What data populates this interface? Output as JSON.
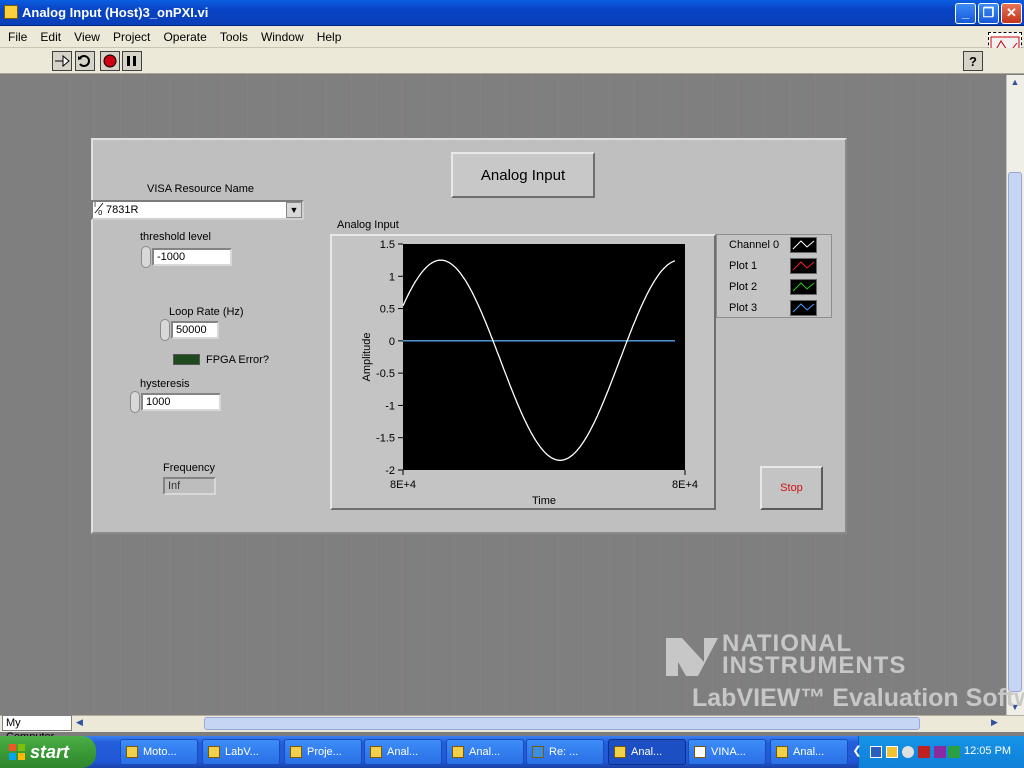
{
  "window": {
    "title": "Analog Input (Host)3_onPXI.vi",
    "minimize": "_",
    "maximize": "❐",
    "close": "✕"
  },
  "menu": [
    "File",
    "Edit",
    "View",
    "Project",
    "Operate",
    "Tools",
    "Window",
    "Help"
  ],
  "toolbar": {
    "help": "?"
  },
  "controls": {
    "visa_label": "VISA Resource Name",
    "visa_value": "7831R",
    "visa_prefix": "I/0",
    "threshold_label": "threshold level",
    "threshold_value": "-1000",
    "loop_rate_label": "Loop Rate (Hz)",
    "loop_rate_value": "50000",
    "fpga_error_label": "FPGA Error?",
    "hysteresis_label": "hysteresis",
    "hysteresis_value": "1000",
    "frequency_label": "Frequency",
    "frequency_value": "Inf",
    "decoration_title": "Analog Input",
    "stop_label": "Stop"
  },
  "chart_data": {
    "type": "line",
    "title": "Analog Input",
    "xlabel": "Time",
    "ylabel": "Amplitude",
    "ylim": [
      -2,
      1.5
    ],
    "yticks": [
      "1.5",
      "1",
      "0.5",
      "0",
      "-0.5",
      "-1",
      "-1.5",
      "-2"
    ],
    "xticks": [
      "8E+4",
      "8E+4"
    ],
    "background": "#000000",
    "series": [
      {
        "name": "Channel 0",
        "color": "#ffffff",
        "shape": "sine",
        "amplitude": 1.55,
        "offset": -0.3,
        "phase_deg": 33,
        "cycles": 1.14
      },
      {
        "name": "Plot 1",
        "color": "#ff2020",
        "shape": "constant",
        "value": 0
      },
      {
        "name": "Plot 2",
        "color": "#20d020",
        "shape": "constant",
        "value": 0
      },
      {
        "name": "Plot 3",
        "color": "#4aa0ff",
        "shape": "constant",
        "value": 0
      }
    ]
  },
  "watermark": {
    "line1": "NATIONAL",
    "line2": "INSTRUMENTS",
    "line3": "LabVIEW™ Evaluation Software"
  },
  "status": {
    "location": "My Computer"
  },
  "taskbar": {
    "start": "start",
    "tasks": [
      "Moto...",
      "LabV...",
      "Proje...",
      "Anal...",
      "Anal...",
      "Re: ...",
      "Anal...",
      "VINA...",
      "Anal..."
    ],
    "clock": "12:05 PM"
  }
}
